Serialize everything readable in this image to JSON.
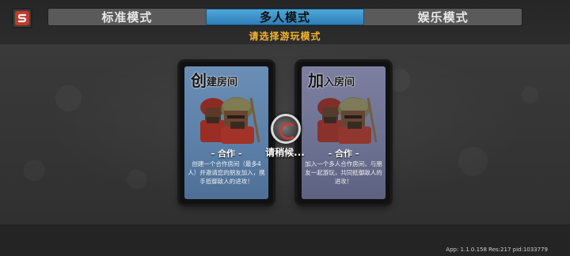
{
  "tabs": [
    {
      "label": "标准模式",
      "active": false
    },
    {
      "label": "多人模式",
      "active": true
    },
    {
      "label": "娱乐模式",
      "active": false
    }
  ],
  "subtitle": "请选择游玩模式",
  "cards": {
    "create": {
      "title_big": "创",
      "title_rest": "建房间",
      "mode_tag": "- 合作 -",
      "description": "创建一个合作房间（最多4人）并邀请您的朋友加入，携手抵御敌人的进攻！"
    },
    "join": {
      "title_big": "加",
      "title_rest": "入房间",
      "mode_tag": "- 合作 -",
      "description": "加入一个多人合作房间，与朋友一起游玩，共同抵御敌人的进攻！"
    }
  },
  "loading_text": "请稍候...",
  "version_text": "App: 1.1.0.158 Res:217 pid:1033779",
  "icons": {
    "back": "s-logo-icon",
    "spinner": "loading-spinner-icon",
    "warriors": "warriors-icon"
  },
  "colors": {
    "tab_active": "#3f96cc",
    "subtitle": "#f5b530",
    "create_card": "#5b7fa8",
    "join_card": "#6c7199"
  }
}
